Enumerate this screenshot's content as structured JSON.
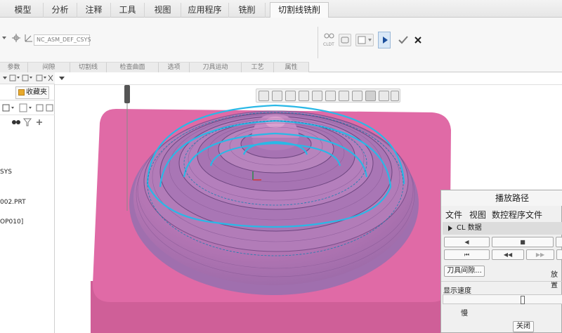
{
  "ribbon": {
    "tabs": [
      "模型",
      "分析",
      "注释",
      "工具",
      "视图",
      "应用程序",
      "铣削",
      "切割线铣削"
    ],
    "active_tab": "切割线铣削",
    "csys_value": "NC_ASM_DEF_CSYS",
    "groups": [
      "参数",
      "间隙",
      "切割线",
      "检查曲面",
      "选项",
      "刀具运动",
      "工艺",
      "属性"
    ],
    "cldt_label": "CLDT"
  },
  "left_panel": {
    "favorites_tab": "收藏夹",
    "tree_items": [
      "SYS",
      "002.PRT",
      "OP010]"
    ]
  },
  "dialog": {
    "title": "播放路径",
    "menu": [
      "文件",
      "视图",
      "数控程序文件"
    ],
    "cl_data": "CL 数据",
    "tool_clearance_button": "刀具间隙...",
    "play_label": "放置",
    "speed_label": "显示速度",
    "slow_label": "慢",
    "close_button": "关闭"
  },
  "colors": {
    "workpiece": "#e06aa6",
    "toolpath": "#2ab8e6",
    "accent": "#1c4f9c"
  }
}
